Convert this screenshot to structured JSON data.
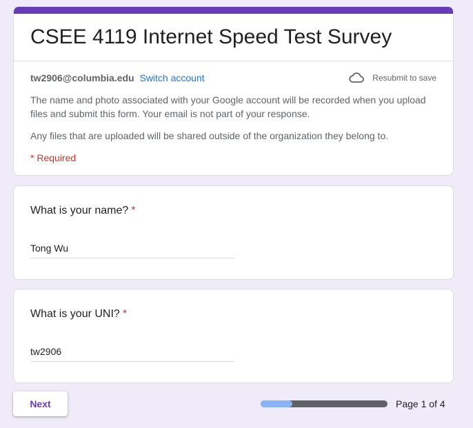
{
  "form": {
    "title": "CSEE 4119 Internet Speed Test Survey",
    "accent_color": "#673ab7"
  },
  "account": {
    "email": "tw2906@columbia.edu",
    "switch_label": "Switch account",
    "save_status": "Resubmit to save",
    "save_icon": "cloud-icon"
  },
  "info": {
    "paragraph1": "The name and photo associated with your Google account will be recorded when you upload files and submit this form. Your email is not part of your response.",
    "paragraph2": "Any files that are uploaded will be shared outside of the organization they belong to.",
    "required_note": "* Required"
  },
  "questions": [
    {
      "title": "What is your name?",
      "required_mark": "*",
      "answer": "Tong Wu"
    },
    {
      "title": "What is your UNI?",
      "required_mark": "*",
      "answer": "tw2906"
    }
  ],
  "footer": {
    "next_label": "Next",
    "progress_fraction": 0.25,
    "page_text": "Page 1 of 4",
    "progress_color": "#8ab4f8"
  }
}
